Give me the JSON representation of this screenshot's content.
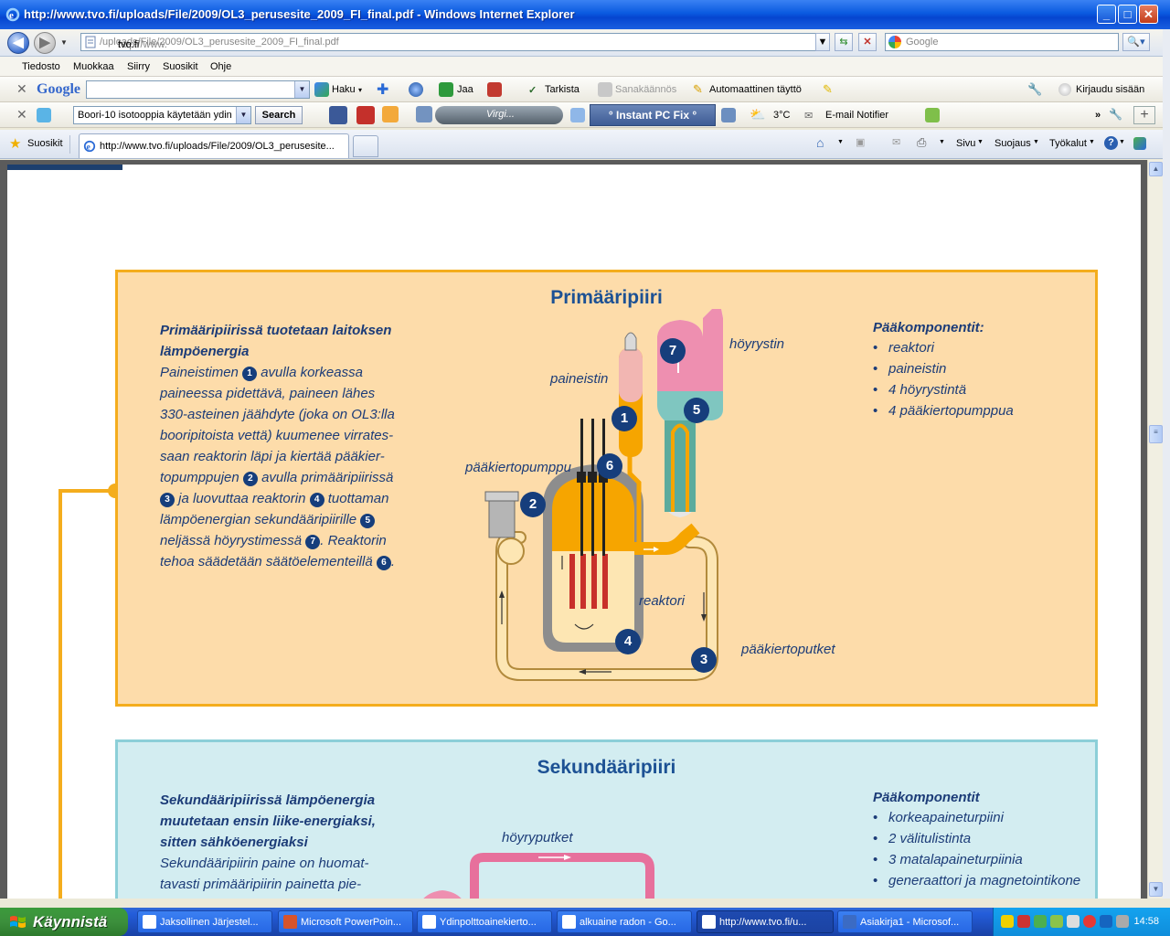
{
  "window": {
    "title": "http://www.tvo.fi/uploads/File/2009/OL3_perusesite_2009_FI_final.pdf - Windows Internet Explorer",
    "minimize": "_",
    "maximize": "□",
    "close": "✕"
  },
  "address": {
    "prefix": "http://www.",
    "host": "tvo.fi",
    "path": "/uploads/File/2009/OL3_perusesite_2009_FI_final.pdf",
    "search_placeholder": "Google"
  },
  "menu": [
    "Tiedosto",
    "Muokkaa",
    "Siirry",
    "Suosikit",
    "Ohje"
  ],
  "google_toolbar": {
    "logo": "Google",
    "haku": "Haku",
    "jaa": "Jaa",
    "tarkista": "Tarkista",
    "sanakaannos": "Sanakäännös",
    "automaattinen": "Automaattinen täyttö",
    "kirjaudu": "Kirjaudu sisään"
  },
  "toolbar2": {
    "search_value": "Boori-10 isotooppia käytetään ydin",
    "search_btn": "Search",
    "radio": "Virgi...",
    "instant_fix": "° Instant PC Fix °",
    "weather": "3°C",
    "email": "E-mail Notifier"
  },
  "tabs": {
    "favorites": "Suosikit",
    "active_tab": "http://www.tvo.fi/uploads/File/2009/OL3_perusesite...",
    "sivu": "Sivu",
    "suojaus": "Suojaus",
    "tyokalut": "Työkalut"
  },
  "primary": {
    "title": "Primääripiiri",
    "heading": [
      "Primääripiirissä tuotetaan laitoksen",
      "lämpöenergia"
    ],
    "lines": [
      [
        "Paineistimen ",
        "1",
        " avulla korkeassa"
      ],
      [
        "paineessa pidettävä, paineen lähes"
      ],
      [
        "330-asteinen jäähdyte (joka on OL3:lla"
      ],
      [
        "booripitoista vettä) kuumenee virrates-"
      ],
      [
        "saan reaktorin läpi ja kiertää pääkier-"
      ],
      [
        "topumppujen ",
        "2",
        " avulla primääripiirissä"
      ],
      [
        "",
        "3",
        " ja luovuttaa reaktorin ",
        "4",
        " tuottaman"
      ],
      [
        "lämpöenergian sekundääripiirille ",
        "5"
      ],
      [
        "neljässä höyrystimessä ",
        "7",
        ". Reaktorin"
      ],
      [
        "tehoa säädetään säätöelementeillä ",
        "6",
        "."
      ]
    ],
    "components_heading": "Pääkomponentit:",
    "components": [
      "reaktori",
      "paineistin",
      "4 höyrystintä",
      "4 pääkiertopumppua"
    ],
    "labels": {
      "paineistin": "paineistin",
      "hoyrystin": "höyrystin",
      "paakiertopumppu": "pääkiertopumppu",
      "reaktori": "reaktori",
      "paakiertoputket": "pääkiertoputket"
    },
    "markers": [
      "1",
      "2",
      "3",
      "4",
      "5",
      "6",
      "7"
    ]
  },
  "secondary": {
    "title": "Sekundääripiiri",
    "heading": [
      "Sekundääripiirissä lämpöenergia",
      "muutetaan ensin liike-energiaksi,",
      "sitten sähköenergiaksi"
    ],
    "lines": [
      "Sekundääripiirin paine on huomat-",
      "tavasti primääripiirin painetta pie-"
    ],
    "components_heading": "Pääkomponentit",
    "components": [
      "korkeapaineturpiini",
      "2 välitulistinta",
      "3 matalapaineturpiinia",
      "generaattori ja magnetointikone"
    ],
    "label_hoyryputket": "höyryputket"
  },
  "taskbar": {
    "start": "Käynnistä",
    "tasks": [
      "Jaksollinen Järjestel...",
      "Microsoft PowerPoin...",
      "Ydinpolttoainekierto...",
      "alkuaine radon - Go...",
      "http://www.tvo.fi/u...",
      "Asiakirja1 - Microsof..."
    ],
    "clock": "14:58"
  },
  "colors": {
    "panel1_bg": "#fddcaa",
    "panel1_border": "#f4ad1d",
    "panel2_bg": "#d3edf1",
    "panel2_border": "#8ccfd8",
    "title_blue": "#1c5194",
    "marker": "#163e7c"
  }
}
